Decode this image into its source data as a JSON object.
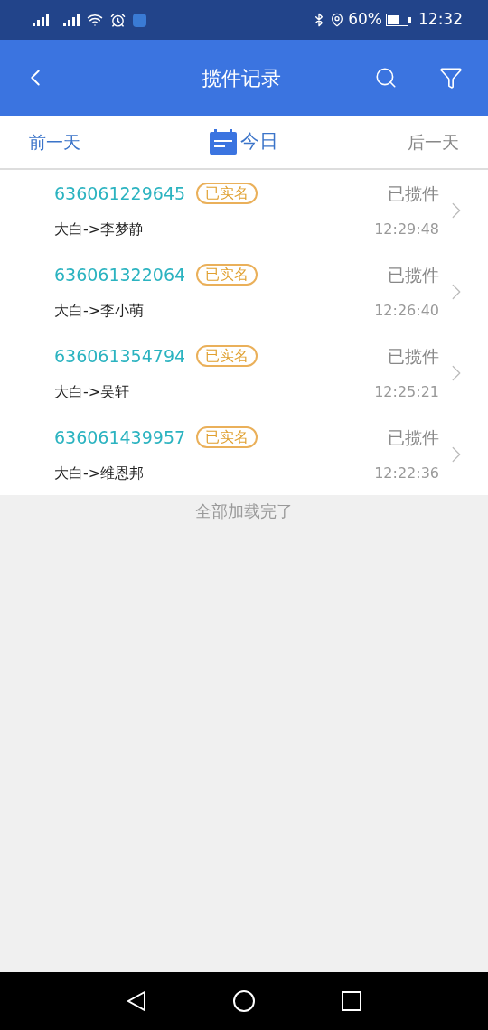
{
  "status_bar": {
    "battery": "60%",
    "time": "12:32"
  },
  "header": {
    "title": "揽件记录"
  },
  "date_bar": {
    "prev": "前一天",
    "today": "今日",
    "next": "后一天"
  },
  "records": [
    {
      "number": "636061229645",
      "badge": "已实名",
      "status": "已揽件",
      "route": "大白->李梦静",
      "time": "12:29:48"
    },
    {
      "number": "636061322064",
      "badge": "已实名",
      "status": "已揽件",
      "route": "大白->李小萌",
      "time": "12:26:40"
    },
    {
      "number": "636061354794",
      "badge": "已实名",
      "status": "已揽件",
      "route": "大白->吴轩",
      "time": "12:25:21"
    },
    {
      "number": "636061439957",
      "badge": "已实名",
      "status": "已揽件",
      "route": "大白->维恩邦",
      "time": "12:22:36"
    }
  ],
  "footer_note": "全部加载完了"
}
